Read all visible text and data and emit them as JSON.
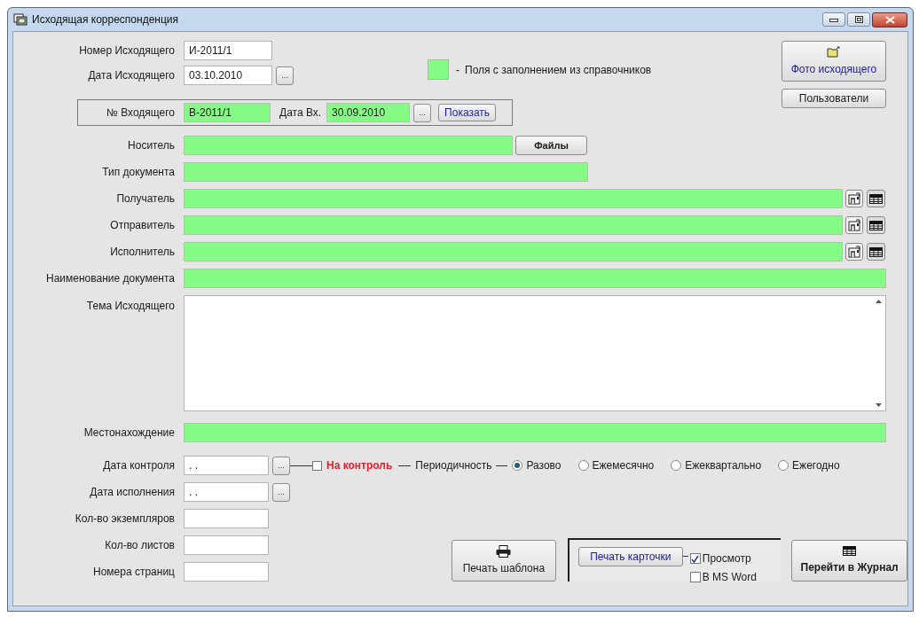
{
  "window": {
    "title": "Исходящая корреспонденция"
  },
  "outgoing_number": {
    "label": "Номер Исходящего",
    "value": "И-2011/1"
  },
  "outgoing_date": {
    "label": "Дата Исходящего",
    "value": "03.10.2010",
    "button": "..."
  },
  "legend": {
    "dash": "-",
    "text": "Поля с заполнением из справочников"
  },
  "photo_button": "Фото исходящего",
  "users_button": "Пользователи",
  "incoming": {
    "number_label": "№ Входящего",
    "number": "В-2011/1",
    "date_label": "Дата Вх.",
    "date": "30.09.2010",
    "date_button": "...",
    "show_button": "Показать"
  },
  "fields": [
    {
      "label": "Носитель",
      "kind": "files",
      "button": "Файлы"
    },
    {
      "label": "Тип документа",
      "kind": "short"
    },
    {
      "label": "Получатель",
      "kind": "lookup"
    },
    {
      "label": "Отправитель",
      "kind": "lookup"
    },
    {
      "label": "Исполнитель",
      "kind": "lookup"
    },
    {
      "label": "Наименование документа",
      "kind": "full"
    }
  ],
  "subject": {
    "label": "Тема Исходящего"
  },
  "location": {
    "label": "Местонахождение"
  },
  "control_date": {
    "label": "Дата контроля",
    "value": ". .",
    "button": "..."
  },
  "on_control": {
    "label": "На контроль",
    "checked": false
  },
  "periodicity": {
    "label": "Периодичность",
    "options": [
      {
        "label": "Разово",
        "selected": true
      },
      {
        "label": "Ежемесячно",
        "selected": false
      },
      {
        "label": "Ежеквартально",
        "selected": false
      },
      {
        "label": "Ежегодно",
        "selected": false
      }
    ]
  },
  "execution_date": {
    "label": "Дата исполнения",
    "value": ". .",
    "button": "..."
  },
  "counts": [
    {
      "label": "Кол-во экземпляров"
    },
    {
      "label": "Кол-во листов"
    },
    {
      "label": "Номера страниц"
    }
  ],
  "print_template_button": "Печать шаблона",
  "print_card": {
    "button": "Печать карточки",
    "options": [
      {
        "label": "Просмотр",
        "checked": true
      },
      {
        "label": "В MS Word",
        "checked": false
      }
    ]
  },
  "journal_button": "Перейти в Журнал"
}
